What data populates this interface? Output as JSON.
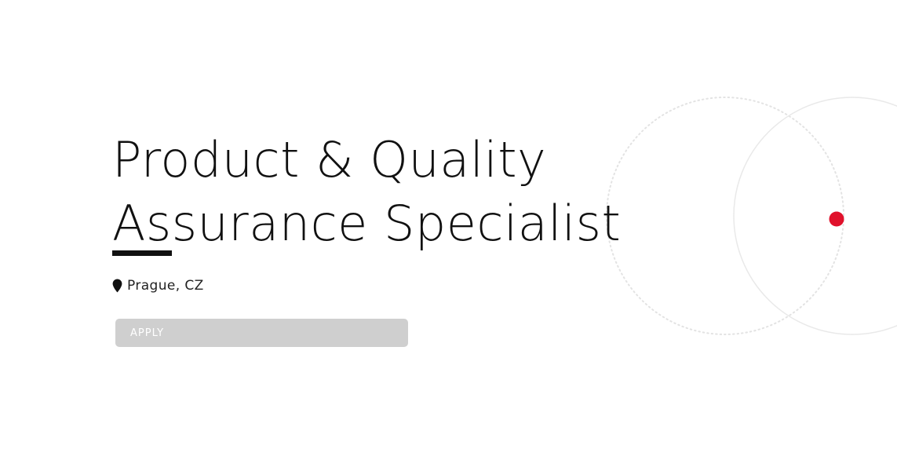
{
  "job": {
    "title": "Product & Quality Assurance Specialist",
    "location": "Prague, CZ",
    "apply_label": "APPLY"
  },
  "icons": {
    "location": "map-pin-icon"
  },
  "colors": {
    "text": "#111111",
    "accent": "#e0112b",
    "button_bg": "#cfcfcf",
    "button_text": "#ffffff",
    "decor_lines": "#e6e6e6"
  }
}
